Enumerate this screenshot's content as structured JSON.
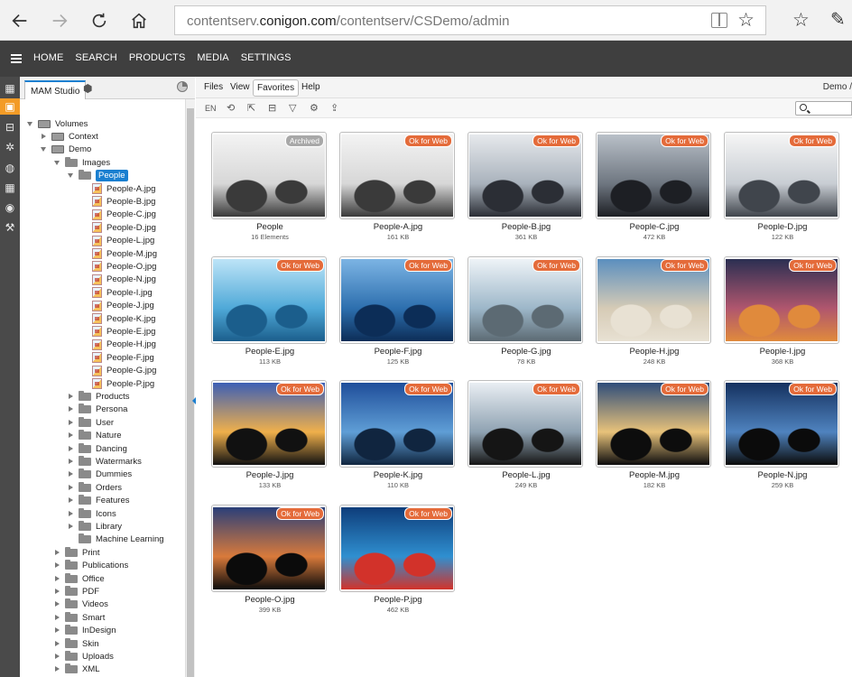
{
  "browser": {
    "url_prefix": "contentserv.",
    "url_domain": "conigon.com",
    "url_path": "/contentserv/CSDemo/admin"
  },
  "nav": {
    "items": [
      "HOME",
      "SEARCH",
      "PRODUCTS",
      "MEDIA",
      "SETTINGS"
    ]
  },
  "tree_panel": {
    "tab_label": "MAM Studio"
  },
  "tree": [
    {
      "label": "Volumes",
      "depth": 0,
      "kind": "drive",
      "toggle": "open"
    },
    {
      "label": "Context",
      "depth": 1,
      "kind": "drive",
      "toggle": "closed"
    },
    {
      "label": "Demo",
      "depth": 1,
      "kind": "drive",
      "toggle": "open"
    },
    {
      "label": "Images",
      "depth": 2,
      "kind": "folder",
      "toggle": "open"
    },
    {
      "label": "People",
      "depth": 3,
      "kind": "folder",
      "toggle": "open",
      "selected": true
    },
    {
      "label": "People-A.jpg",
      "depth": 4,
      "kind": "file"
    },
    {
      "label": "People-B.jpg",
      "depth": 4,
      "kind": "file"
    },
    {
      "label": "People-C.jpg",
      "depth": 4,
      "kind": "file"
    },
    {
      "label": "People-D.jpg",
      "depth": 4,
      "kind": "file"
    },
    {
      "label": "People-L.jpg",
      "depth": 4,
      "kind": "file"
    },
    {
      "label": "People-M.jpg",
      "depth": 4,
      "kind": "file"
    },
    {
      "label": "People-O.jpg",
      "depth": 4,
      "kind": "file"
    },
    {
      "label": "People-N.jpg",
      "depth": 4,
      "kind": "file"
    },
    {
      "label": "People-I.jpg",
      "depth": 4,
      "kind": "file"
    },
    {
      "label": "People-J.jpg",
      "depth": 4,
      "kind": "file"
    },
    {
      "label": "People-K.jpg",
      "depth": 4,
      "kind": "file"
    },
    {
      "label": "People-E.jpg",
      "depth": 4,
      "kind": "file"
    },
    {
      "label": "People-H.jpg",
      "depth": 4,
      "kind": "file"
    },
    {
      "label": "People-F.jpg",
      "depth": 4,
      "kind": "file"
    },
    {
      "label": "People-G.jpg",
      "depth": 4,
      "kind": "file"
    },
    {
      "label": "People-P.jpg",
      "depth": 4,
      "kind": "file"
    },
    {
      "label": "Products",
      "depth": 3,
      "kind": "folder",
      "toggle": "closed"
    },
    {
      "label": "Persona",
      "depth": 3,
      "kind": "folder",
      "toggle": "closed"
    },
    {
      "label": "User",
      "depth": 3,
      "kind": "folder",
      "toggle": "closed"
    },
    {
      "label": "Nature",
      "depth": 3,
      "kind": "folder",
      "toggle": "closed"
    },
    {
      "label": "Dancing",
      "depth": 3,
      "kind": "folder",
      "toggle": "closed"
    },
    {
      "label": "Watermarks",
      "depth": 3,
      "kind": "folder",
      "toggle": "closed"
    },
    {
      "label": "Dummies",
      "depth": 3,
      "kind": "folder",
      "toggle": "closed"
    },
    {
      "label": "Orders",
      "depth": 3,
      "kind": "folder",
      "toggle": "closed"
    },
    {
      "label": "Features",
      "depth": 3,
      "kind": "folder",
      "toggle": "closed"
    },
    {
      "label": "Icons",
      "depth": 3,
      "kind": "folder",
      "toggle": "closed"
    },
    {
      "label": "Library",
      "depth": 3,
      "kind": "folder",
      "toggle": "closed"
    },
    {
      "label": "Machine Learning",
      "depth": 3,
      "kind": "folder",
      "toggle": "none"
    },
    {
      "label": "Print",
      "depth": 2,
      "kind": "folder",
      "toggle": "closed"
    },
    {
      "label": "Publications",
      "depth": 2,
      "kind": "folder",
      "toggle": "closed"
    },
    {
      "label": "Office",
      "depth": 2,
      "kind": "folder",
      "toggle": "closed"
    },
    {
      "label": "PDF",
      "depth": 2,
      "kind": "folder",
      "toggle": "closed"
    },
    {
      "label": "Videos",
      "depth": 2,
      "kind": "folder",
      "toggle": "closed"
    },
    {
      "label": "Smart",
      "depth": 2,
      "kind": "folder",
      "toggle": "closed"
    },
    {
      "label": "InDesign",
      "depth": 2,
      "kind": "folder",
      "toggle": "closed"
    },
    {
      "label": "Skin",
      "depth": 2,
      "kind": "folder",
      "toggle": "closed"
    },
    {
      "label": "Uploads",
      "depth": 2,
      "kind": "folder",
      "toggle": "closed"
    },
    {
      "label": "XML",
      "depth": 2,
      "kind": "folder",
      "toggle": "closed"
    }
  ],
  "menu": {
    "files": "Files",
    "view": "View",
    "favorites": "Favorites",
    "help": "Help",
    "breadcrumb": "Demo /"
  },
  "toolbar": {
    "lang": "EN"
  },
  "colors": {
    "accent": "#f39b26",
    "badge": "#e46b3a",
    "selection": "#1a7fd0"
  },
  "cards": [
    {
      "name": "People",
      "size": "16 Elements",
      "badge": "Archived",
      "badge_style": "gray",
      "palette": [
        "#f3f3f3",
        "#d7d7d7",
        "#3a3a3a"
      ]
    },
    {
      "name": "People-A.jpg",
      "size": "161 KB",
      "badge": "Ok for Web",
      "palette": [
        "#f3f3f3",
        "#d7d7d7",
        "#3a3a3a"
      ]
    },
    {
      "name": "People-B.jpg",
      "size": "361 KB",
      "badge": "Ok for Web",
      "palette": [
        "#e6e9ec",
        "#a9b2bc",
        "#2b2e35"
      ]
    },
    {
      "name": "People-C.jpg",
      "size": "472 KB",
      "badge": "Ok for Web",
      "palette": [
        "#b9c0c8",
        "#6e7680",
        "#1d1f24"
      ]
    },
    {
      "name": "People-D.jpg",
      "size": "122 KB",
      "badge": "Ok for Web",
      "palette": [
        "#f5f5f5",
        "#c8cdd3",
        "#40454c"
      ]
    },
    {
      "name": "People-E.jpg",
      "size": "113 KB",
      "badge": "Ok for Web",
      "palette": [
        "#bde4f7",
        "#4fa9d8",
        "#1b5e8c"
      ]
    },
    {
      "name": "People-F.jpg",
      "size": "125 KB",
      "badge": "Ok for Web",
      "palette": [
        "#7cb4e4",
        "#2d6fae",
        "#0c2d57"
      ]
    },
    {
      "name": "People-G.jpg",
      "size": "78 KB",
      "badge": "Ok for Web",
      "palette": [
        "#eef3f7",
        "#9db7c9",
        "#5c6a73"
      ]
    },
    {
      "name": "People-H.jpg",
      "size": "248 KB",
      "badge": "Ok for Web",
      "palette": [
        "#5b8fbf",
        "#d6cbb6",
        "#e8e1d3"
      ]
    },
    {
      "name": "People-I.jpg",
      "size": "368 KB",
      "badge": "Ok for Web",
      "palette": [
        "#2b2f52",
        "#b0566e",
        "#e08a3c"
      ]
    },
    {
      "name": "People-J.jpg",
      "size": "133 KB",
      "badge": "Ok for Web",
      "palette": [
        "#3d5fb5",
        "#f0b04b",
        "#111111"
      ]
    },
    {
      "name": "People-K.jpg",
      "size": "110 KB",
      "badge": "Ok for Web",
      "palette": [
        "#1f4e9a",
        "#5f9ed6",
        "#10253f"
      ]
    },
    {
      "name": "People-L.jpg",
      "size": "249 KB",
      "badge": "Ok for Web",
      "palette": [
        "#e9eef3",
        "#8fa2b2",
        "#151515"
      ]
    },
    {
      "name": "People-M.jpg",
      "size": "182 KB",
      "badge": "Ok for Web",
      "palette": [
        "#2f4d7a",
        "#e8c27a",
        "#0d0d0d"
      ]
    },
    {
      "name": "People-N.jpg",
      "size": "259 KB",
      "badge": "Ok for Web",
      "palette": [
        "#15315f",
        "#4f83bf",
        "#0b0b0b"
      ]
    },
    {
      "name": "People-O.jpg",
      "size": "399 KB",
      "badge": "Ok for Web",
      "palette": [
        "#2a3f79",
        "#d97a3b",
        "#0b0b0b"
      ]
    },
    {
      "name": "People-P.jpg",
      "size": "462 KB",
      "badge": "Ok for Web",
      "palette": [
        "#0e3d7a",
        "#2f8fd0",
        "#d2322a"
      ]
    }
  ]
}
